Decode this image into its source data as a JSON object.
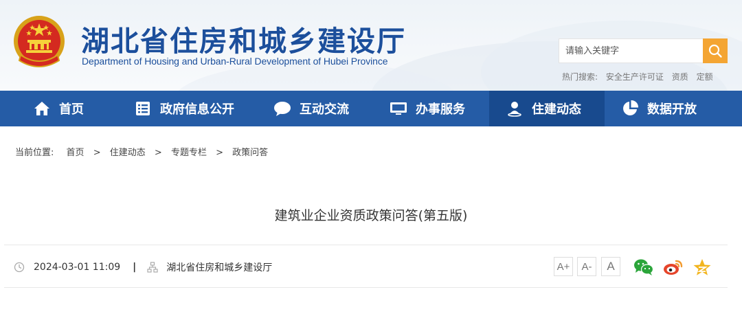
{
  "header": {
    "site_title": "湖北省住房和城乡建设厅",
    "site_subtitle": "Department of Housing and Urban-Rural Development of Hubei Province",
    "emblem_icon": "national-emblem-icon"
  },
  "search": {
    "placeholder": "请输入关键字",
    "button_icon": "search-icon",
    "hot_label": "热门搜索:",
    "hot_terms": [
      "安全生产许可证",
      "资质",
      "定额"
    ]
  },
  "nav": {
    "items": [
      {
        "label": "首页",
        "icon": "home-icon"
      },
      {
        "label": "政府信息公开",
        "icon": "document-icon"
      },
      {
        "label": "互动交流",
        "icon": "chat-bubble-icon"
      },
      {
        "label": "办事服务",
        "icon": "monitor-icon"
      },
      {
        "label": "住建动态",
        "icon": "person-location-icon",
        "active": true
      },
      {
        "label": "数据开放",
        "icon": "pie-chart-icon"
      }
    ],
    "active_color": "#184a8e",
    "bar_color": "#255ca6"
  },
  "breadcrumb": {
    "prefix": "当前位置:",
    "items": [
      "首页",
      "住建动态",
      "专题专栏",
      "政策问答"
    ],
    "separator": ">"
  },
  "article": {
    "title": "建筑业企业资质政策问答(第五版)",
    "date": "2024-03-01 11:09",
    "separator": "|",
    "source": "湖北省住房和城乡建设厅"
  },
  "tools": {
    "font_sizes": [
      "A+",
      "A-",
      "A"
    ],
    "share_icons": [
      "wechat-icon",
      "weibo-icon",
      "favorite-star-icon"
    ]
  },
  "colors": {
    "brand_blue": "#1c4f9c",
    "accent_orange": "#f4a533"
  }
}
